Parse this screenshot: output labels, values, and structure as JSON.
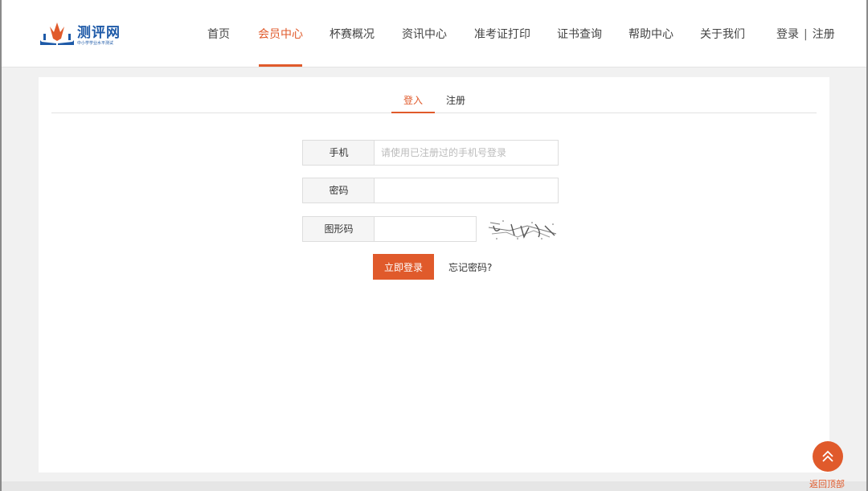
{
  "header": {
    "logo": {
      "title": "测评网",
      "subtitle": "中小学学业水平测试"
    },
    "nav": [
      {
        "label": "首页",
        "active": false
      },
      {
        "label": "会员中心",
        "active": true
      },
      {
        "label": "杯赛概况",
        "active": false
      },
      {
        "label": "资讯中心",
        "active": false
      },
      {
        "label": "准考证打印",
        "active": false
      },
      {
        "label": "证书查询",
        "active": false
      },
      {
        "label": "帮助中心",
        "active": false
      },
      {
        "label": "关于我们",
        "active": false
      }
    ],
    "login_link": "登录",
    "separator": "|",
    "register_link": "注册"
  },
  "tabs": [
    {
      "label": "登入",
      "active": true
    },
    {
      "label": "注册",
      "active": false
    }
  ],
  "form": {
    "phone_label": "手机",
    "phone_placeholder": "请使用已注册过的手机号登录",
    "phone_value": "",
    "password_label": "密码",
    "password_value": "",
    "captcha_label": "图形码",
    "captcha_value": "",
    "submit_label": "立即登录",
    "forgot_label": "忘记密码?"
  },
  "back_to_top": {
    "icon": "double-chevron-up-icon",
    "label": "返回顶部"
  },
  "colors": {
    "accent": "#e05a2b",
    "brand": "#1e5aa8"
  }
}
